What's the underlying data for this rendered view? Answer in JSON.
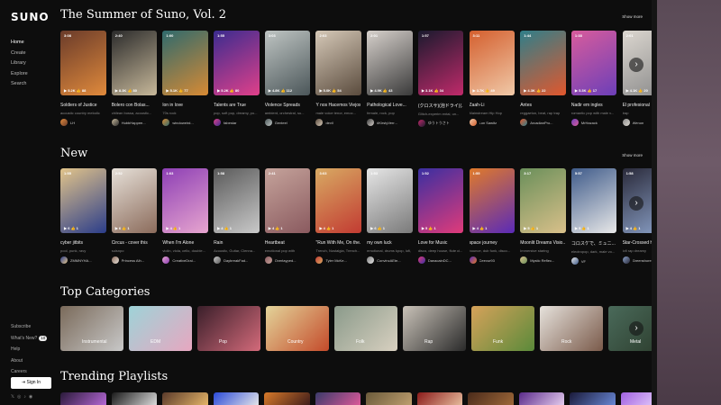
{
  "app": {
    "logo": "SUNO"
  },
  "nav": {
    "items": [
      "Home",
      "Create",
      "Library",
      "Explore",
      "Search"
    ]
  },
  "bottom_nav": {
    "subscribe": "Subscribe",
    "whats_new": "What's New?",
    "whats_new_count": "10",
    "help": "Help",
    "about": "About",
    "careers": "Careers",
    "sign_in": "Sign In"
  },
  "socials": [
    "𝕏",
    "◎",
    "♪",
    "◉"
  ],
  "section1": {
    "title": "The Summer of Suno, Vol. 2",
    "show_more": "Show more",
    "cards": [
      {
        "title": "Soldiers of Justice",
        "style": "acoustic country melodic",
        "user": "LH",
        "dur": "3:08",
        "plays": "5.2K",
        "likes": "88",
        "colors": [
          "#6a3b2a",
          "#e08a3c"
        ]
      },
      {
        "title": "Bolero con Bolas...",
        "style": "chilean bossa, acoustic...",
        "user": "HubbHappee...",
        "dur": "2:40",
        "plays": "8.3K",
        "likes": "80",
        "colors": [
          "#2b2b2b",
          "#c7b89a"
        ]
      },
      {
        "title": "lon in love",
        "style": "70s rock",
        "user": "windoweird...",
        "dur": "1:00",
        "plays": "5.1K",
        "likes": "77",
        "colors": [
          "#2f6a6d",
          "#d78a34"
        ]
      },
      {
        "title": "Talents are True",
        "style": "pop, soft pop, dreamy, po...",
        "user": "fabestar",
        "dur": "1:55",
        "plays": "5.2K",
        "likes": "80",
        "colors": [
          "#3b2c8f",
          "#e0408a"
        ]
      },
      {
        "title": "Violence Spreads",
        "style": "ambient, orchestral, su...",
        "user": "Genteel",
        "dur": "3:03",
        "plays": "4.8K",
        "likes": "112",
        "colors": [
          "#bfc5c3",
          "#4b5659"
        ]
      },
      {
        "title": "Y nos Hacemos Viejos",
        "style": "male voice tenor, emoc...",
        "user": "devil",
        "dur": "2:03",
        "plays": "5.0K",
        "likes": "54",
        "colors": [
          "#d6c9b8",
          "#5a4b3d"
        ]
      },
      {
        "title": "Pathological Love...",
        "style": "female, rock, pop",
        "user": "#KirstyVerr...",
        "dur": "2:01",
        "plays": "4.9K",
        "likes": "43",
        "colors": [
          "#d7d1cc",
          "#3a3a3a"
        ]
      },
      {
        "title": "(クロスサ)(泡ドライ)(...",
        "style": "Glitch-experim ental, un...",
        "user": "ゆうトうさト",
        "dur": "1:57",
        "plays": "3.1K",
        "likes": "34",
        "colors": [
          "#1a1a2e",
          "#c02a6a"
        ]
      },
      {
        "title": "Zaah-Li",
        "style": "Mainstream Hip Hop",
        "user": "Lon Sawitz",
        "dur": "3:11",
        "plays": "3.7K",
        "likes": "49",
        "colors": [
          "#d45f2e",
          "#f0c9a8"
        ]
      },
      {
        "title": "Antes",
        "style": "reggaeton, beat, rap trap",
        "user": "ArcadianPro...",
        "dur": "1:44",
        "plays": "4.3K",
        "likes": "22",
        "colors": [
          "#2f7f8a",
          "#e1572d"
        ]
      },
      {
        "title": "Nadir em ingles",
        "style": "romantic pop with male v...",
        "user": "MrHazack",
        "dur": "1:38",
        "plays": "5.3K",
        "likes": "17",
        "colors": [
          "#d85c9c",
          "#6c3fb8"
        ]
      },
      {
        "title": "El profesional",
        "style": "trap",
        "user": "Wenon",
        "dur": "2:01",
        "plays": "4.1K",
        "likes": "20",
        "colors": [
          "#dcd7d0",
          "#8a8a8a"
        ]
      }
    ]
  },
  "section2": {
    "title": "New",
    "show_more": "Show more",
    "cards": [
      {
        "title": "cyber jitbits",
        "style": "pool, punk, ravy",
        "user": "ZMMNYHA...",
        "dur": "1:55",
        "plays": "6",
        "likes": "1",
        "colors": [
          "#e2c48a",
          "#2b3d8a"
        ]
      },
      {
        "title": "Circus - cover this",
        "style": "suisnpo",
        "user": "Princess Alh...",
        "dur": "2:52",
        "plays": "6",
        "likes": "1",
        "colors": [
          "#e6e0d8",
          "#8b6b5b"
        ]
      },
      {
        "title": "When I'm Alone",
        "style": "violin, viola, cello, double...",
        "user": "CreativeDrai...",
        "dur": "1:03",
        "plays": "4",
        "likes": "1",
        "colors": [
          "#8d3fb5",
          "#e7a5cf"
        ]
      },
      {
        "title": "Rain",
        "style": "Acoustic, Guitar, Clenna...",
        "user": "DaybreakFad...",
        "dur": "1:58",
        "plays": "4",
        "likes": "1",
        "colors": [
          "#5a5a5a",
          "#c9c9c9"
        ]
      },
      {
        "title": "Heartbeat",
        "style": "emotional pop with",
        "user": "Overlayped...",
        "dur": "2:41",
        "plays": "4",
        "likes": "1",
        "colors": [
          "#c5a39b",
          "#8a5a5f"
        ]
      },
      {
        "title": "\"Run With Me, On the...",
        "style": "Trench, Nostalgia, Trench...",
        "user": "Tyler McKe...",
        "dur": "3:03",
        "plays": "4",
        "likes": "1",
        "colors": [
          "#d8aa63",
          "#c23b32"
        ]
      },
      {
        "title": "my own luck",
        "style": "emotional, drums kpop, lofi, ...",
        "user": "ConvincAEte...",
        "dur": "1:53",
        "plays": "6",
        "likes": "1",
        "colors": [
          "#e6e6e6",
          "#7a7a7a"
        ]
      },
      {
        "title": "Love for Music",
        "style": "disco, deep house, flute ci...",
        "user": "DanacainDC...",
        "dur": "1:52",
        "plays": "5",
        "likes": "1",
        "colors": [
          "#3a2fa1",
          "#e03b7a"
        ]
      },
      {
        "title": "space journey",
        "style": "bounce, dub funk, disco...",
        "user": "Ceevur93",
        "dur": "1:55",
        "plays": "4",
        "likes": "1",
        "colors": [
          "#e07a2a",
          "#5a2ab8"
        ]
      },
      {
        "title": "Moonlit Dreams Visio...",
        "style": "Immersive staring",
        "user": "Mystic Reflec...",
        "dur": "3:17",
        "plays": "5",
        "likes": "1",
        "colors": [
          "#6a8f5a",
          "#d9c08a"
        ]
      },
      {
        "title": "コロスケで、ミュニ...",
        "style": "electropop, dark, male vo...",
        "user": "VF",
        "dur": "5:57",
        "plays": "5",
        "likes": "1",
        "colors": [
          "#3f5b8a",
          "#e8e8e8"
        ]
      },
      {
        "title": "Star-Crossed Hearts",
        "style": "lofi rap dreamy",
        "user": "Greenshore...",
        "dur": "1:58",
        "plays": "4",
        "likes": "1",
        "colors": [
          "#2a2a3a",
          "#8aa0c7"
        ]
      }
    ]
  },
  "section3": {
    "title": "Top Categories",
    "categories": [
      {
        "label": "Instrumental",
        "colors": [
          "#7a6a5a",
          "#c8c8c8"
        ]
      },
      {
        "label": "EDM",
        "colors": [
          "#9ed3d8",
          "#e7a7c0"
        ]
      },
      {
        "label": "Pop",
        "colors": [
          "#3a1f2a",
          "#d36a7a"
        ]
      },
      {
        "label": "Country",
        "colors": [
          "#e3d49a",
          "#c44a2a"
        ]
      },
      {
        "label": "Folk",
        "colors": [
          "#8a9a8a",
          "#d8d0c0"
        ]
      },
      {
        "label": "Rap",
        "colors": [
          "#c9c2b8",
          "#2a2a2a"
        ]
      },
      {
        "label": "Funk",
        "colors": [
          "#d6a25a",
          "#5a8a3a"
        ]
      },
      {
        "label": "Rock",
        "colors": [
          "#e6e2dc",
          "#7a5a4a"
        ]
      },
      {
        "label": "Metal",
        "colors": [
          "#4a6a5a",
          "#2a3a2a"
        ]
      }
    ]
  },
  "section4": {
    "title": "Trending Playlists",
    "playlists": [
      {
        "colors": [
          "#2a1a3a",
          "#b86ad8"
        ]
      },
      {
        "colors": [
          "#1a1a1a",
          "#e0e0e0"
        ]
      },
      {
        "colors": [
          "#5a3a2a",
          "#e8b86a"
        ]
      },
      {
        "colors": [
          "#2a4ad8",
          "#e8e8e8"
        ]
      },
      {
        "colors": [
          "#d87a2a",
          "#3a1a1a"
        ]
      },
      {
        "colors": [
          "#3a3a6a",
          "#e05a9a"
        ]
      },
      {
        "colors": [
          "#6a5a3a",
          "#c0a070"
        ]
      },
      {
        "colors": [
          "#8a1a1a",
          "#e8c0a0"
        ]
      },
      {
        "colors": [
          "#4a2a1a",
          "#a06a3a"
        ]
      },
      {
        "colors": [
          "#5a2a8a",
          "#e8d0f0"
        ]
      },
      {
        "colors": [
          "#1a1a3a",
          "#6a8ad8"
        ]
      },
      {
        "colors": [
          "#a060e0",
          "#f0e0ff"
        ]
      }
    ]
  },
  "icons": {
    "arrow": "chevron-right-icon",
    "play": "play-icon",
    "like": "thumbs-up-icon",
    "more": "more-icon"
  }
}
